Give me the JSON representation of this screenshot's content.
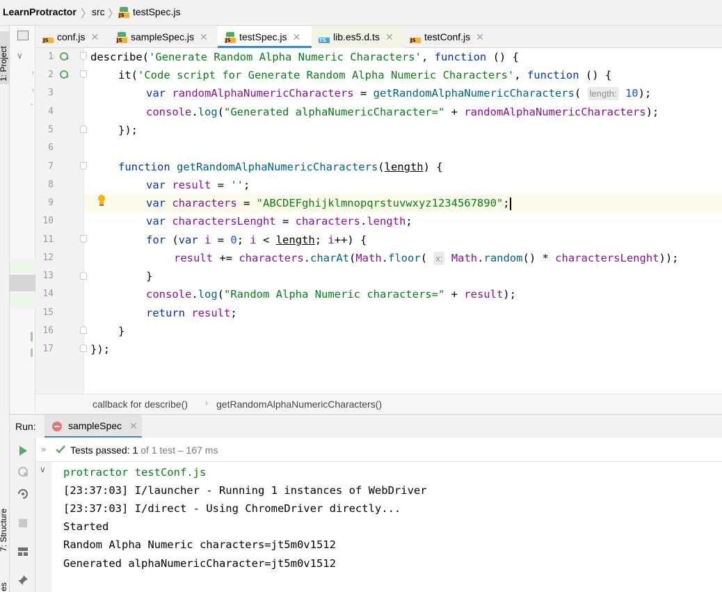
{
  "nav": {
    "project": "LearnProtractor",
    "folder": "src",
    "file": "testSpec.js"
  },
  "side": {
    "project_label": "1: Project",
    "structure_label": "7: Structure",
    "favorites_label": "es"
  },
  "tabs": [
    {
      "label": "conf.js",
      "type": "JS"
    },
    {
      "label": "sampleSpec.js",
      "type": "JS"
    },
    {
      "label": "testSpec.js",
      "type": "JS",
      "active": true
    },
    {
      "label": "lib.es5.d.ts",
      "type": "TS"
    },
    {
      "label": "testConf.js",
      "type": "JS"
    }
  ],
  "gutter": {
    "line_numbers": [
      "1",
      "2",
      "3",
      "4",
      "5",
      "6",
      "7",
      "8",
      "9",
      "10",
      "11",
      "12",
      "13",
      "14",
      "15",
      "16",
      "17"
    ]
  },
  "code": {
    "l1_a": "describe(",
    "l1_b": "'Generate Random Alpha Numeric Characters'",
    "l1_c": ", ",
    "l1_d": "function",
    "l1_e": " () {",
    "l2_a": "it(",
    "l2_b": "'Code script for Generate Random Alpha Numeric Characters'",
    "l2_c": ", ",
    "l2_d": "function",
    "l2_e": " () {",
    "l3_a": "var",
    "l3_b": " randomAlphaNumericCharacters",
    "l3_c": " = ",
    "l3_d": "getRandomAlphaNumericCharacters",
    "l3_e": "( ",
    "l3_hint": "length:",
    "l3_f": " 10",
    "l3_g": ");",
    "l4_a": "console",
    "l4_b": ".",
    "l4_c": "log",
    "l4_d": "(",
    "l4_e": "\"Generated alphaNumericCharacter=\"",
    "l4_f": " + ",
    "l4_g": "randomAlphaNumericCharacters",
    "l4_h": ");",
    "l5": "});",
    "l7_a": "function",
    "l7_b": " getRandomAlphaNumericCharacters",
    "l7_c": "(",
    "l7_d": "length",
    "l7_e": ") {",
    "l8_a": "var",
    "l8_b": " result",
    "l8_c": " = ",
    "l8_d": "''",
    "l8_e": ";",
    "l9_a": "var",
    "l9_b": " characters",
    "l9_c": " = ",
    "l9_d": "\"ABCDEFghijklmnopqrstuvwxyz1234567890\"",
    "l9_e": ";",
    "l10_a": "var",
    "l10_b": " charactersLenght",
    "l10_c": " = ",
    "l10_d": "characters",
    "l10_e": ".",
    "l10_f": "length",
    "l10_g": ";",
    "l11_a": "for",
    "l11_b": " (",
    "l11_c": "var",
    "l11_d": " i",
    "l11_e": " = ",
    "l11_f": "0",
    "l11_g": "; ",
    "l11_h": "i",
    "l11_i": " < ",
    "l11_j": "length",
    "l11_k": "; ",
    "l11_l": "i",
    "l11_m": "++) {",
    "l12_a": "result",
    "l12_b": " += ",
    "l12_c": "characters",
    "l12_d": ".",
    "l12_e": "charAt",
    "l12_f": "(",
    "l12_g": "Math",
    "l12_h": ".",
    "l12_i": "floor",
    "l12_j": "( ",
    "l12_hint": "x:",
    "l12_k": " Math",
    "l12_l": ".",
    "l12_m": "random",
    "l12_n": "() * ",
    "l12_o": "charactersLenght",
    "l12_p": "));",
    "l13": "}",
    "l14_a": "console",
    "l14_b": ".",
    "l14_c": "log",
    "l14_d": "(",
    "l14_e": "\"Random Alpha Numeric characters=\"",
    "l14_f": " + ",
    "l14_g": "result",
    "l14_h": ");",
    "l15_a": "return",
    "l15_b": " result",
    "l15_c": ";",
    "l16": "}",
    "l17": "});"
  },
  "breadcrumbs": {
    "item1": "callback for describe()",
    "item2": "getRandomAlphaNumericCharacters()"
  },
  "run": {
    "label": "Run:",
    "config": "sampleSpec",
    "status_prefix": "Tests passed:",
    "status_count": "1",
    "status_suffix": "of 1 test – 167 ms"
  },
  "console": {
    "lines": [
      "protractor testConf.js",
      "[23:37:03] I/launcher - Running 1 instances of WebDriver",
      "[23:37:03] I/direct - Using ChromeDriver directly...",
      "Started",
      "Random Alpha Numeric characters=jt5m0v1512",
      "Generated alphaNumericCharacter=jt5m0v1512"
    ]
  },
  "colors": {
    "keyword": "#0033b3",
    "string": "#067d17",
    "variable": "#871094",
    "method": "#00627a",
    "number": "#1750eb",
    "accent": "#4083c9",
    "pass": "#59a869"
  },
  "icons": {
    "run_gutter": "run-test-icon",
    "bulb": "intention-bulb-icon",
    "rerun": "rerun-icon",
    "stop": "stop-icon",
    "pin": "pin-icon",
    "check": "check-icon"
  }
}
